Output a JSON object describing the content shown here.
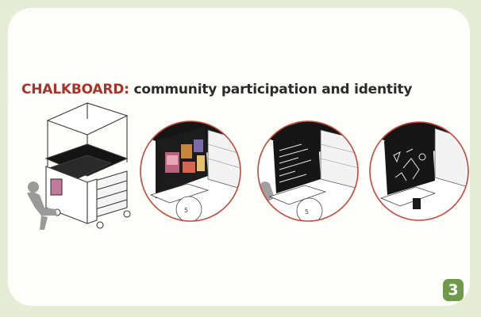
{
  "heading": {
    "accent": "CHALKBOARD:",
    "rest": " community participation and identity"
  },
  "page_badge": "3",
  "illustration_panels": [
    {
      "content": "chalkboard with colorful posted images"
    },
    {
      "content": "chalkboard with handwritten notes"
    },
    {
      "content": "chalkboard with chalk drawings"
    }
  ],
  "colors": {
    "page_background": "#e6edd6",
    "card": "#fdfdf9",
    "accent_red": "#a8332a",
    "heading_text": "#2b2b2b",
    "badge_green": "#6f9a4a",
    "circle_outline": "#c44a3a",
    "chalkboard": "#141414"
  }
}
